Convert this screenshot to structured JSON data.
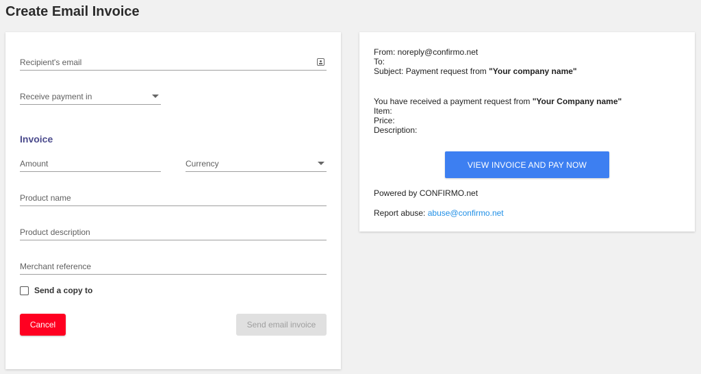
{
  "page": {
    "title": "Create Email Invoice"
  },
  "form": {
    "recipient_email": {
      "label": "Recipient's email",
      "icon": "contact-card-icon"
    },
    "receive_payment": {
      "label": "Receive payment in"
    },
    "invoice_section": "Invoice",
    "amount": {
      "label": "Amount"
    },
    "currency": {
      "label": "Currency"
    },
    "product_name": {
      "label": "Product name"
    },
    "product_description": {
      "label": "Product description"
    },
    "merchant_reference": {
      "label": "Merchant reference"
    },
    "send_copy": {
      "label": "Send a copy to",
      "checked": false
    },
    "cancel_label": "Cancel",
    "send_label": "Send email invoice"
  },
  "preview": {
    "from": "From: noreply@confirmo.net",
    "to": "To:",
    "subject_prefix": "Subject: Payment request from ",
    "subject_company": "\"Your company name\"",
    "body_prefix": "You have received a payment request from ",
    "body_company": "\"Your Company name\"",
    "item": "Item:",
    "price": "Price:",
    "description": "Description:",
    "view_button": "VIEW INVOICE AND PAY NOW",
    "powered_by": "Powered by CONFIRMO.net",
    "report_prefix": "Report abuse: ",
    "report_email": "abuse@confirmo.net"
  },
  "colors": {
    "cancel": "#ff0021",
    "primary": "#3d7ff1",
    "section_title": "#4a4a8c",
    "link": "#1e8ee6",
    "disabled_bg": "#e0e0e0"
  }
}
